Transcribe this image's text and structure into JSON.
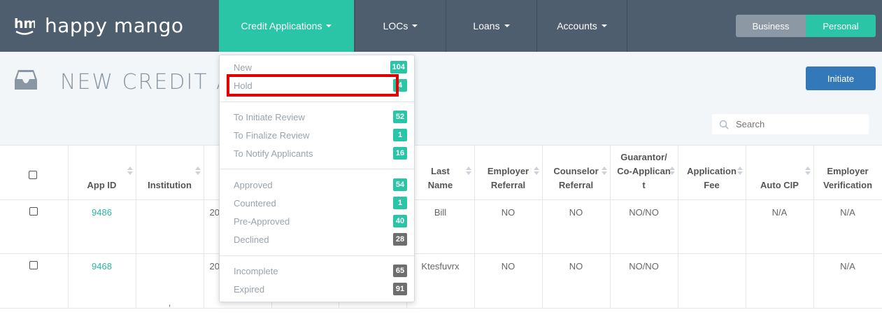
{
  "brand": {
    "name": "happy mango"
  },
  "nav": {
    "items": [
      {
        "label": "Credit Applications"
      },
      {
        "label": "LOCs"
      },
      {
        "label": "Loans"
      },
      {
        "label": "Accounts"
      }
    ],
    "toggle": {
      "business": "Business",
      "personal": "Personal"
    }
  },
  "page": {
    "title": "NEW CREDIT A",
    "initiate_label": "Initiate",
    "search_placeholder": "Search"
  },
  "dropdown": {
    "items": [
      {
        "label": "New",
        "count": "104"
      },
      {
        "label": "Hold",
        "count": "4"
      },
      {
        "label": "To Initiate Review",
        "count": "52"
      },
      {
        "label": "To Finalize Review",
        "count": "1"
      },
      {
        "label": "To Notify Applicants",
        "count": "16"
      },
      {
        "label": "Approved",
        "count": "54"
      },
      {
        "label": "Countered",
        "count": "1"
      },
      {
        "label": "Pre-Approved",
        "count": "40"
      },
      {
        "label": "Declined",
        "count": "28"
      },
      {
        "label": "Incomplete",
        "count": "65"
      },
      {
        "label": "Expired",
        "count": "91"
      }
    ]
  },
  "table": {
    "headers": {
      "app_id": "App ID",
      "institution": "Institution",
      "last_name_1": "Last",
      "last_name_2": "Name",
      "employer_referral_1": "Employer",
      "employer_referral_2": "Referral",
      "counselor_referral_1": "Counselor",
      "counselor_referral_2": "Referral",
      "guarantor_1": "Guarantor/",
      "guarantor_2": "Co-Applican",
      "guarantor_3": "t",
      "application_fee_1": "Application",
      "application_fee_2": "Fee",
      "auto_cip": "Auto CIP",
      "employer_verification_1": "Employer",
      "employer_verification_2": "Verification"
    },
    "rows": [
      {
        "app_id": "9486",
        "institution": "",
        "date": "20",
        "last_name": "Bill",
        "employer_referral": "NO",
        "counselor_referral": "NO",
        "guarantor": "NO/NO",
        "application_fee": "",
        "auto_cip": "N/A",
        "employer_verification": "N/A"
      },
      {
        "app_id": "9468",
        "institution": ",",
        "date": "20",
        "last_name": "Ktesfuvrx",
        "employer_referral": "NO",
        "counselor_referral": "NO",
        "guarantor": "NO/NO",
        "application_fee": "",
        "auto_cip": "",
        "employer_verification": "N/A"
      }
    ]
  },
  "colors": {
    "nav_bg": "#4e5e6e",
    "accent_teal": "#2ac4a6",
    "primary_blue": "#3378b8",
    "highlight_red": "#e00000"
  }
}
